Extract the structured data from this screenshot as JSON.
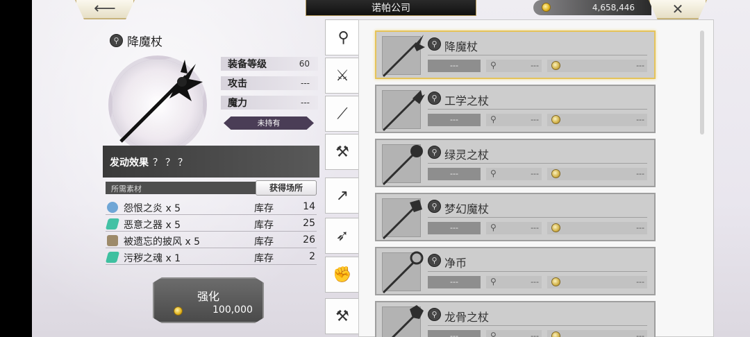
{
  "header": {
    "title": "诺帕公司",
    "gold": "4,658,446",
    "back_icon": "arrow-left-icon",
    "close_icon": "close-icon"
  },
  "item": {
    "name": "降魔杖",
    "stats": [
      {
        "label": "装备等级",
        "value": "60"
      },
      {
        "label": "攻击",
        "value": "---"
      },
      {
        "label": "魔力",
        "value": "---"
      }
    ],
    "owned_status": "未持有",
    "effect_label": "发动效果",
    "effect_value": "？？？"
  },
  "materials": {
    "header": "所需素材",
    "source_button": "获得场所",
    "items": [
      {
        "name": "怨恨之炎 x 5",
        "stock_label": "库存",
        "qty": "14",
        "color": "#6fa6d6"
      },
      {
        "name": "恶意之器 x 5",
        "stock_label": "库存",
        "qty": "25",
        "color": "#43c1a5"
      },
      {
        "name": "被遗忘的披风 x 5",
        "stock_label": "库存",
        "qty": "26",
        "color": "#9d8a6a"
      },
      {
        "name": "污秽之魂 x 1",
        "stock_label": "库存",
        "qty": "2",
        "color": "#3fc0a0"
      }
    ]
  },
  "upgrade": {
    "label": "强化",
    "cost": "100,000"
  },
  "tabs": [
    {
      "icon": "staff-icon",
      "glyph": "⚲"
    },
    {
      "icon": "sword-icon",
      "glyph": "⚔"
    },
    {
      "icon": "katana-icon",
      "glyph": "⟋"
    },
    {
      "icon": "axe-icon",
      "glyph": "⚒"
    },
    {
      "icon": "spear-icon",
      "glyph": "↗"
    },
    {
      "icon": "bow-icon",
      "glyph": "➶"
    },
    {
      "icon": "fist-icon",
      "glyph": "✊"
    },
    {
      "icon": "hammer-icon",
      "glyph": "⚒"
    }
  ],
  "weapons": [
    {
      "name": "降魔杖",
      "slot1": "---",
      "slot2": "---",
      "slot3": "---",
      "selected": true
    },
    {
      "name": "工学之杖",
      "slot1": "---",
      "slot2": "---",
      "slot3": "---",
      "selected": false
    },
    {
      "name": "绿灵之杖",
      "slot1": "---",
      "slot2": "---",
      "slot3": "---",
      "selected": false
    },
    {
      "name": "梦幻魔杖",
      "slot1": "---",
      "slot2": "---",
      "slot3": "---",
      "selected": false
    },
    {
      "name": "净币",
      "slot1": "---",
      "slot2": "---",
      "slot3": "---",
      "selected": false
    },
    {
      "name": "龙骨之杖",
      "slot1": "---",
      "slot2": "---",
      "slot3": "---",
      "selected": false
    }
  ]
}
